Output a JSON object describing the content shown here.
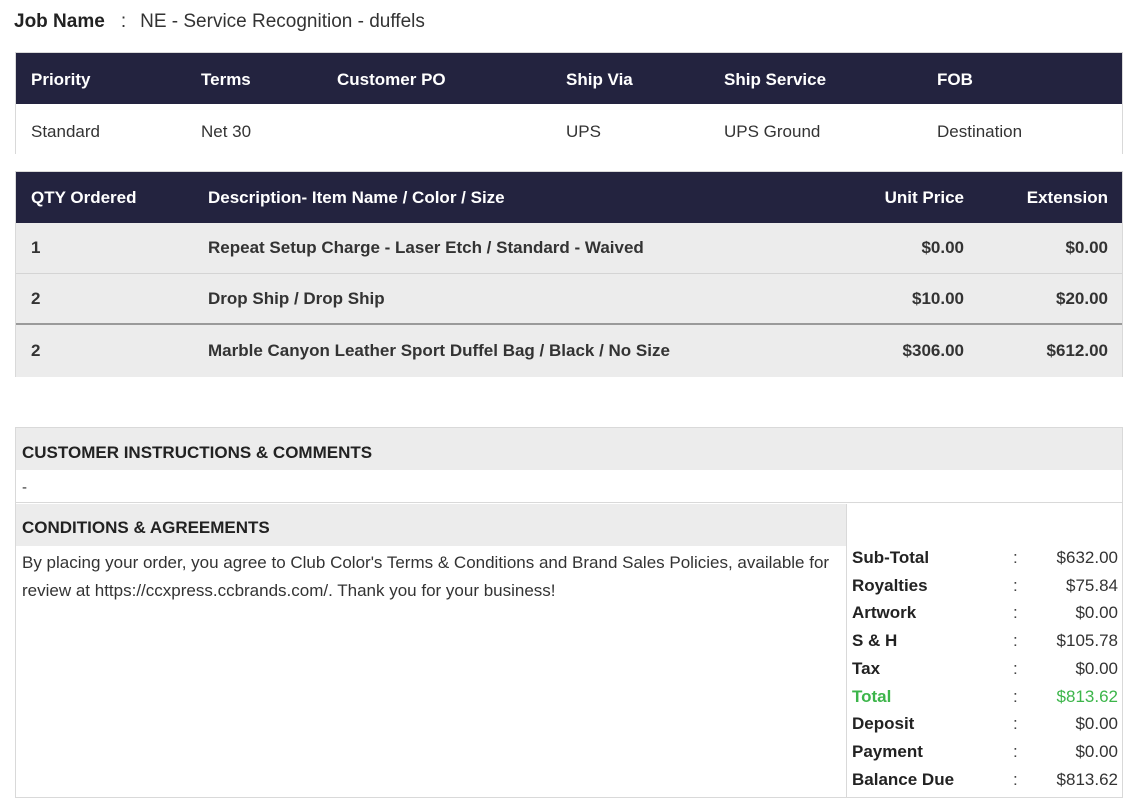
{
  "job": {
    "label": "Job Name",
    "separator": ":",
    "value": "NE - Service Recognition - duffels"
  },
  "order_info": {
    "headers": [
      "Priority",
      "Terms",
      "Customer PO",
      "Ship Via",
      "Ship Service",
      "FOB"
    ],
    "values": [
      "Standard",
      "Net 30",
      "",
      "UPS",
      "UPS Ground",
      "Destination"
    ]
  },
  "items": {
    "headers": {
      "qty": "QTY Ordered",
      "description": "Description- Item Name / Color / Size",
      "unit_price": "Unit Price",
      "extension": "Extension"
    },
    "rows": [
      {
        "qty": "1",
        "description": "Repeat Setup Charge - Laser Etch / Standard - Waived",
        "unit_price": "$0.00",
        "extension": "$0.00"
      },
      {
        "qty": "2",
        "description": "Drop Ship / Drop Ship",
        "unit_price": "$10.00",
        "extension": "$20.00"
      },
      {
        "qty": "2",
        "description": "Marble Canyon Leather Sport Duffel Bag / Black / No Size",
        "unit_price": "$306.00",
        "extension": "$612.00"
      }
    ]
  },
  "instructions": {
    "title": "CUSTOMER INSTRUCTIONS & COMMENTS",
    "text": "-"
  },
  "conditions": {
    "title": "CONDITIONS & AGREEMENTS",
    "text": "By placing your order, you agree to Club Color's Terms & Conditions and Brand Sales Policies, available for review at https://ccxpress.ccbrands.com/. Thank you for your business!"
  },
  "totals": [
    {
      "label": "Sub-Total",
      "separator": ":",
      "value": "$632.00"
    },
    {
      "label": "Royalties",
      "separator": ":",
      "value": "$75.84"
    },
    {
      "label": "Artwork",
      "separator": ":",
      "value": "$0.00"
    },
    {
      "label": "S & H",
      "separator": ":",
      "value": "$105.78"
    },
    {
      "label": "Tax",
      "separator": ":",
      "value": "$0.00"
    },
    {
      "label": "Total",
      "separator": ":",
      "value": "$813.62"
    },
    {
      "label": "Deposit",
      "separator": ":",
      "value": "$0.00"
    },
    {
      "label": "Payment",
      "separator": ":",
      "value": "$0.00"
    },
    {
      "label": "Balance Due",
      "separator": ":",
      "value": "$813.62"
    }
  ],
  "colors": {
    "header_bg": "#23233f",
    "row_bg": "#ececec",
    "total_green": "#3cb54a"
  }
}
